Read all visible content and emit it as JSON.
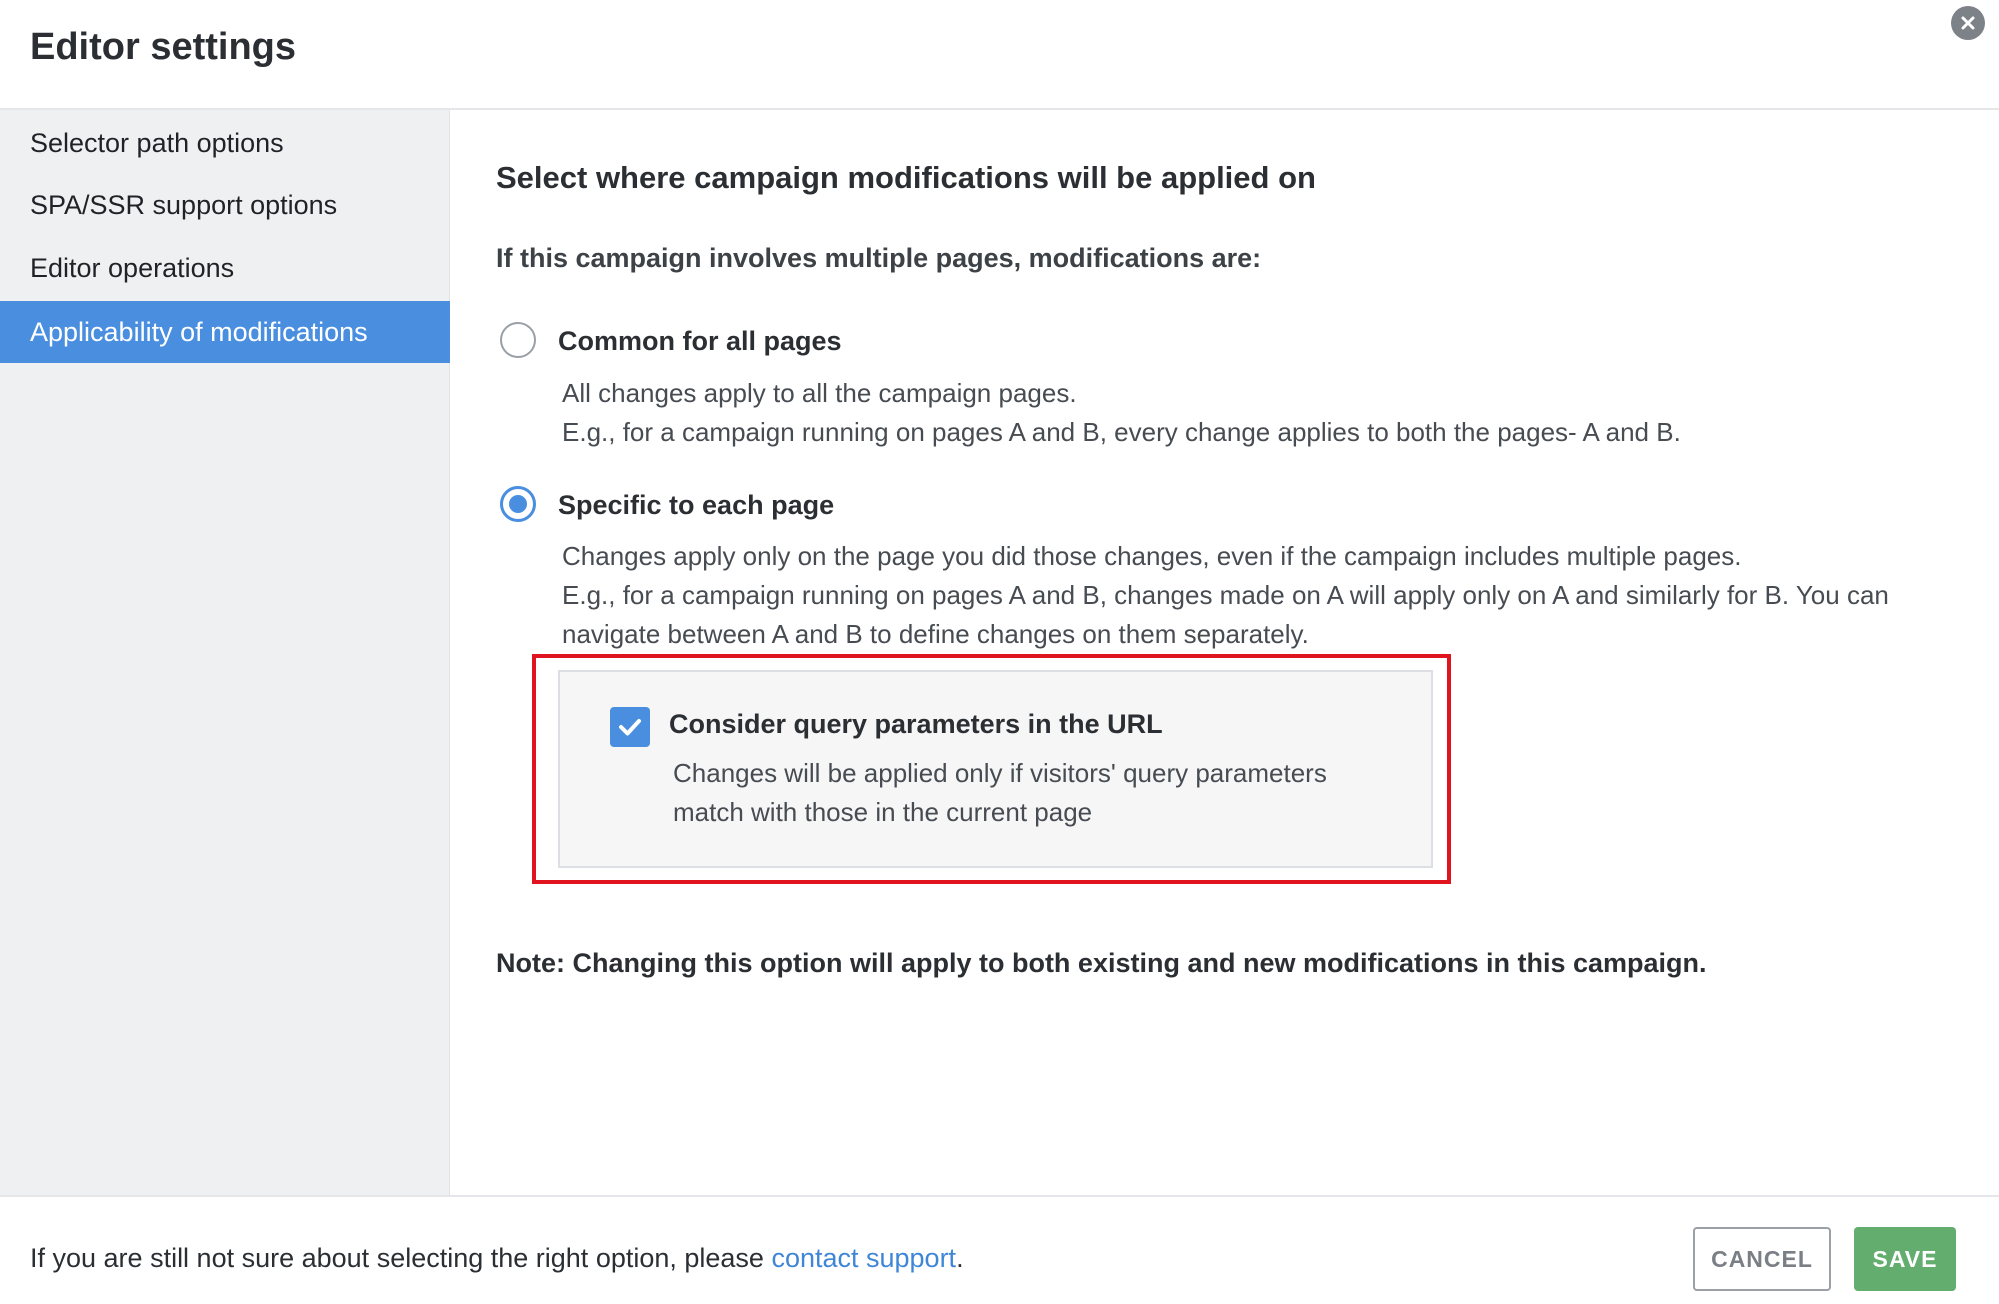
{
  "dialog": {
    "title": "Editor settings"
  },
  "sidebar": {
    "items": [
      {
        "label": "Selector path options"
      },
      {
        "label": "SPA/SSR support options"
      },
      {
        "label": "Editor operations"
      },
      {
        "label": "Applicability of modifications"
      }
    ],
    "active_index": 3
  },
  "main": {
    "heading": "Select where campaign modifications will be applied on",
    "subheading": "If this campaign involves multiple pages, modifications are:",
    "options": [
      {
        "label": "Common for all pages",
        "desc_lines": [
          "All changes apply to all the campaign pages.",
          "E.g., for a campaign running on pages A and B, every change applies to both the pages- A and B."
        ],
        "selected": false
      },
      {
        "label": "Specific to each page",
        "desc_lines": [
          "Changes apply only on the page you did those changes, even if the campaign includes multiple pages.",
          "E.g., for a campaign running on pages A and B, changes made on A will apply only on A and similarly for B. You can navigate between A and B to define changes on them separately."
        ],
        "selected": true
      }
    ],
    "query_params": {
      "label": "Consider query parameters in the URL",
      "desc": "Changes will be applied only if visitors' query parameters match with those in the current page",
      "checked": true
    },
    "note": "Note: Changing this option will apply to both existing and new modifications in this campaign."
  },
  "footer": {
    "help_prefix": "If you are still not sure about selecting the right option, please ",
    "help_link": "contact support",
    "help_suffix": ".",
    "cancel_label": "CANCEL",
    "save_label": "SAVE"
  },
  "colors": {
    "accent": "#4a8fdf",
    "save": "#63ad6e",
    "highlight": "#e0141e",
    "link": "#3f86d6"
  }
}
